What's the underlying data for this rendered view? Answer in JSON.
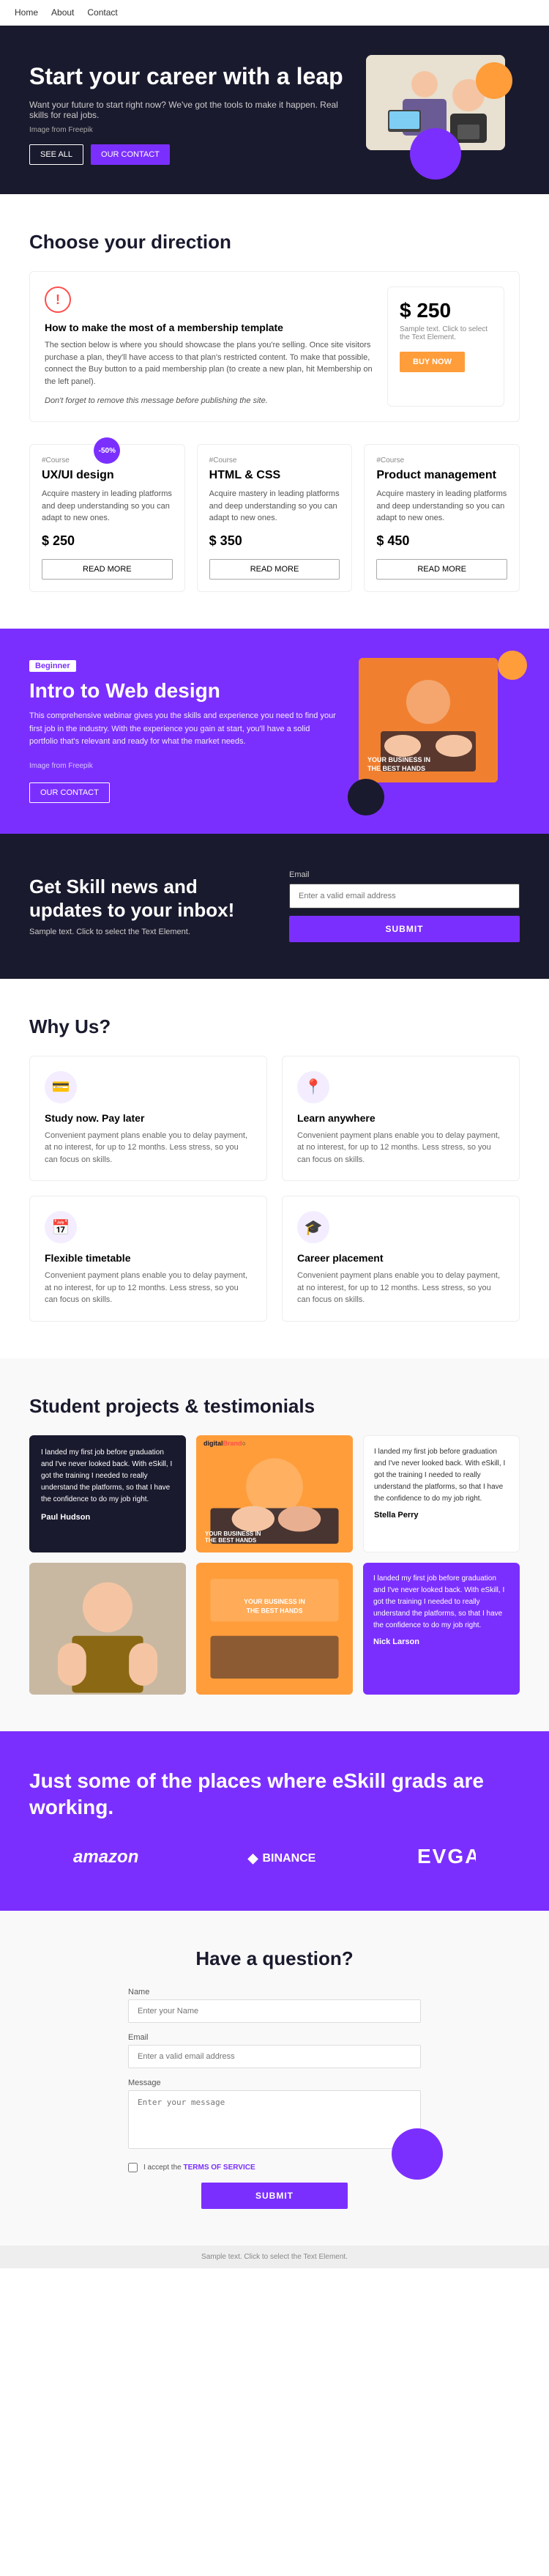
{
  "nav": {
    "links": [
      "Home",
      "About",
      "Contact"
    ]
  },
  "hero": {
    "title": "Start your career with a leap",
    "subtitle": "Want your future to start right now? We've got the tools to make it happen. Real skills for real jobs.",
    "image_credit": "Image from Freepik",
    "btn_see_all": "SEE ALL",
    "btn_contact": "OUR CONTACT"
  },
  "directions": {
    "section_title": "Choose your direction",
    "notice": {
      "icon": "!",
      "heading": "How to make the most of a membership template",
      "body": "The section below is where you should showcase the plans you're selling. Once site visitors purchase a plan, they'll have access to that plan's restricted content. To make that possible, connect the Buy button to a paid membership plan (to create a new plan, hit Membership on the left panel).",
      "italic": "Don't forget to remove this message before publishing the site.",
      "price": "$ 250",
      "price_note": "Sample text. Click to select the Text Element.",
      "btn_buy": "BUY NOW"
    },
    "courses": [
      {
        "badge": "#Course",
        "discount": "-50%",
        "title": "UX/UI design",
        "description": "Acquire mastery in leading platforms and deep understanding so you can adapt to new ones.",
        "price": "$ 250",
        "btn": "READ MORE"
      },
      {
        "badge": "#Course",
        "discount": null,
        "title": "HTML & CSS",
        "description": "Acquire mastery in leading platforms and deep understanding so you can adapt to new ones.",
        "price": "$ 350",
        "btn": "READ MORE"
      },
      {
        "badge": "#Course",
        "discount": null,
        "title": "Product management",
        "description": "Acquire mastery in leading platforms and deep understanding so you can adapt to new ones.",
        "price": "$ 450",
        "btn": "READ MORE"
      }
    ]
  },
  "webinar": {
    "tag": "Beginner",
    "title": "Intro to Web design",
    "description": "This comprehensive webinar gives you the skills and experience you need to find your first job in the industry. With the experience you gain at start, you'll have a solid portfolio that's relevant and ready for what the market needs.",
    "image_credit": "Image from Freepik",
    "btn": "OUR CONTACT",
    "img_text_line1": "YOUR BUSINESS IN",
    "img_text_line2": "THE BEST HANDS"
  },
  "newsletter": {
    "title": "Get Skill news and updates to your inbox!",
    "subtitle": "Sample text. Click to select the Text Element.",
    "email_label": "Email",
    "email_placeholder": "Enter a valid email address",
    "btn_submit": "SUBMIT"
  },
  "why_us": {
    "section_title": "Why Us?",
    "items": [
      {
        "icon": "💳",
        "title": "Study now. Pay later",
        "description": "Convenient payment plans enable you to delay payment, at no interest, for up to 12 months. Less stress, so you can focus on skills."
      },
      {
        "icon": "📍",
        "title": "Learn anywhere",
        "description": "Convenient payment plans enable you to delay payment, at no interest, for up to 12 months. Less stress, so you can focus on skills."
      },
      {
        "icon": "📅",
        "title": "Flexible timetable",
        "description": "Convenient payment plans enable you to delay payment, at no interest, for up to 12 months. Less stress, so you can focus on skills."
      },
      {
        "icon": "🎓",
        "title": "Career placement",
        "description": "Convenient payment plans enable you to delay payment, at no interest, for up to 12 months. Less stress, so you can focus on skills."
      }
    ]
  },
  "testimonials": {
    "section_title": "Student projects & testimonials",
    "items": [
      {
        "type": "dark",
        "text": "I landed my first job before graduation and I've never looked back. With eSkill, I got the training I needed to really understand the platforms, so that I have the confidence to do my job right.",
        "author": "Paul Hudson"
      },
      {
        "type": "orange_img",
        "line1": "YOUR BUSINESS IN",
        "line2": "THE BEST HANDS"
      },
      {
        "type": "light",
        "text": "I landed my first job before graduation and I've never looked back. With eSkill, I got the training I needed to really understand the platforms, so that I have the confidence to do my job right.",
        "author": "Stella Perry"
      },
      {
        "type": "person_img"
      },
      {
        "type": "orange_img2",
        "line1": "YOUR BUSINESS IN",
        "line2": "THE BEST HANDS"
      },
      {
        "type": "purple",
        "text": "I landed my first job before graduation and I've never looked back. With eSkill, I got the training I needed to really understand the platforms, so that I have the confidence to do my job right.",
        "author": "Nick Larson"
      }
    ]
  },
  "partners": {
    "section_title": "Just some of the places where eSkill grads are working.",
    "logos": [
      "amazon",
      "BINANCE",
      "EVGA"
    ]
  },
  "contact": {
    "section_title": "Have a question?",
    "fields": {
      "name_label": "Name",
      "name_placeholder": "Enter your Name",
      "email_label": "Email",
      "email_placeholder": "Enter a valid email address",
      "message_label": "Message",
      "message_placeholder": "Enter your message"
    },
    "terms_text": "I accept the",
    "terms_link": "TERMS OF SERVICE",
    "btn_submit": "SUBMIT"
  },
  "footer": {
    "sample_text": "Sample text. Click to select the Text Element."
  }
}
